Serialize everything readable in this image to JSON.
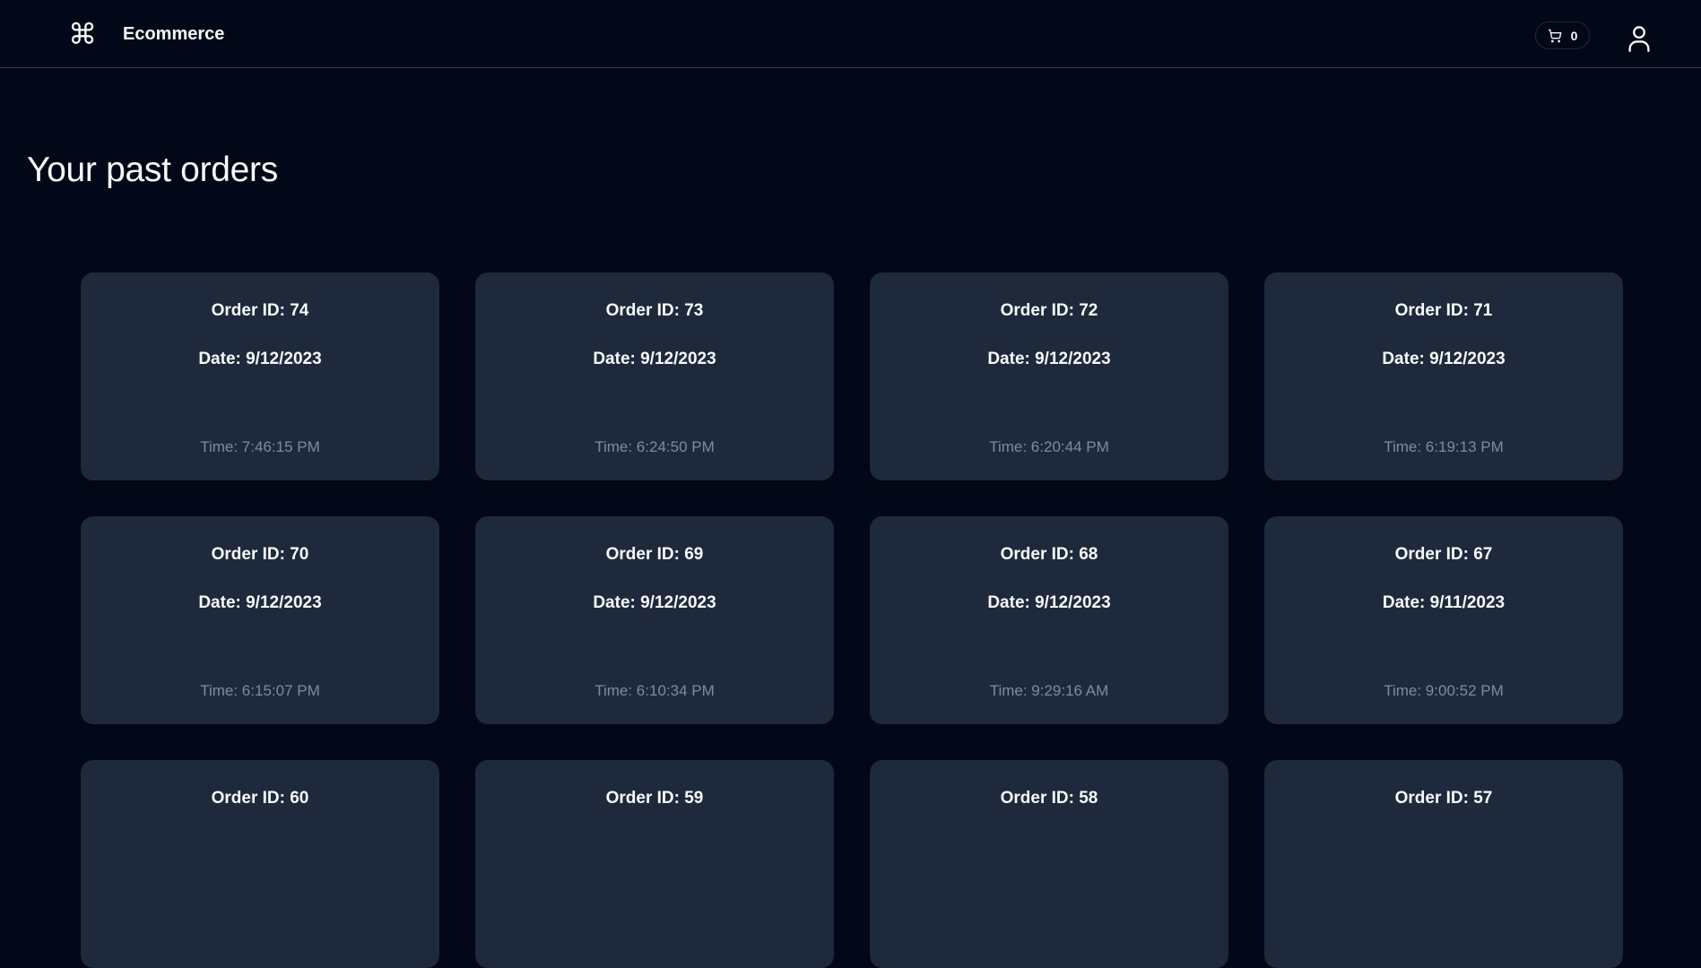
{
  "header": {
    "logo_icon": "command-icon",
    "brand": "Ecommerce",
    "cart_icon": "shopping-cart-icon",
    "cart_count": "0",
    "user_icon": "user-icon"
  },
  "main": {
    "title": "Your past orders",
    "orders": [
      {
        "order_id": "Order ID: 74",
        "date": "Date: 9/12/2023",
        "time": "Time: 7:46:15 PM"
      },
      {
        "order_id": "Order ID: 73",
        "date": "Date: 9/12/2023",
        "time": "Time: 6:24:50 PM"
      },
      {
        "order_id": "Order ID: 72",
        "date": "Date: 9/12/2023",
        "time": "Time: 6:20:44 PM"
      },
      {
        "order_id": "Order ID: 71",
        "date": "Date: 9/12/2023",
        "time": "Time: 6:19:13 PM"
      },
      {
        "order_id": "Order ID: 70",
        "date": "Date: 9/12/2023",
        "time": "Time: 6:15:07 PM"
      },
      {
        "order_id": "Order ID: 69",
        "date": "Date: 9/12/2023",
        "time": "Time: 6:10:34 PM"
      },
      {
        "order_id": "Order ID: 68",
        "date": "Date: 9/12/2023",
        "time": "Time: 9:29:16 AM"
      },
      {
        "order_id": "Order ID: 67",
        "date": "Date: 9/11/2023",
        "time": "Time: 9:00:52 PM"
      },
      {
        "order_id": "Order ID: 60",
        "date": "",
        "time": ""
      },
      {
        "order_id": "Order ID: 59",
        "date": "",
        "time": ""
      },
      {
        "order_id": "Order ID: 58",
        "date": "",
        "time": ""
      },
      {
        "order_id": "Order ID: 57",
        "date": "",
        "time": ""
      }
    ]
  },
  "colors": {
    "background": "#020817",
    "card": "#1e293b",
    "border": "#334155",
    "text": "#f8fafc",
    "muted_text": "#7d8ba3"
  }
}
